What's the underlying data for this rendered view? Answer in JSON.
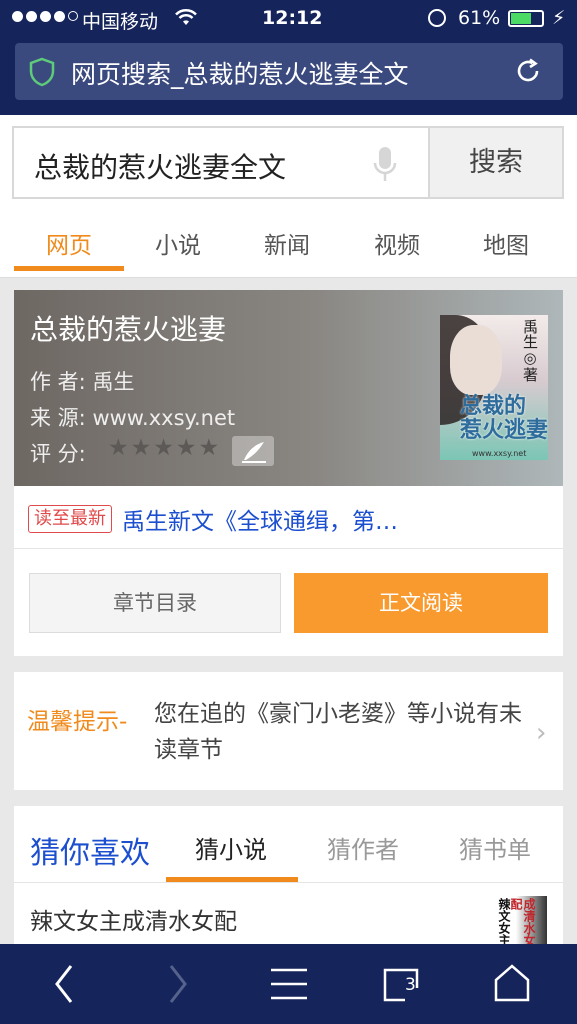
{
  "status_bar": {
    "carrier": "中国移动",
    "time": "12:12",
    "battery_percent": "61%",
    "battery_level": 0.61,
    "signal_bars": 4,
    "signal_max": 5
  },
  "url_bar": {
    "title": "网页搜索_总裁的惹火逃妻全文"
  },
  "search": {
    "query": "总裁的惹火逃妻全文",
    "button_label": "搜索"
  },
  "tabs": [
    {
      "label": "网页",
      "active": true
    },
    {
      "label": "小说",
      "active": false
    },
    {
      "label": "新闻",
      "active": false
    },
    {
      "label": "视频",
      "active": false
    },
    {
      "label": "地图",
      "active": false
    }
  ],
  "novel": {
    "name": "总裁的惹火逃妻",
    "author_label": "作 者:",
    "author": "禹生",
    "source_label": "来 源:",
    "source": "www.xxsy.net",
    "rating_label": "评 分:",
    "rating_stars": 5,
    "cover_author": "禹生◎著",
    "cover_title_line1": "总裁的",
    "cover_title_line2": "惹火逃妻",
    "cover_url": "www.xxsy.net",
    "latest_tag": "读至最新",
    "latest_text": "禹生新文《全球通缉，第…",
    "toc_button": "章节目录",
    "read_button": "正文阅读"
  },
  "notice": {
    "label": "温馨提示-",
    "message": "您在追的《豪门小老婆》等小说有未读章节"
  },
  "guess": {
    "heading": "猜你喜欢",
    "tabs": [
      {
        "label": "猜小说",
        "active": true
      },
      {
        "label": "猜作者",
        "active": false
      },
      {
        "label": "猜书单",
        "active": false
      }
    ],
    "first_item": "辣文女主成清水女配",
    "thumb_text_dark": "辣文女主",
    "thumb_text_red": "成清水女配"
  },
  "toolbar": {
    "tab_count": "3"
  },
  "colors": {
    "nav_bg": "#15245a",
    "accent_orange": "#f08a1c",
    "link_blue": "#1c4fcf",
    "tag_red": "#e04a4a"
  }
}
